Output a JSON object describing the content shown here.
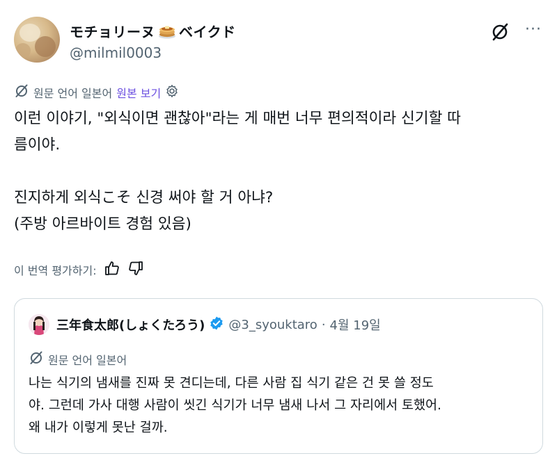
{
  "author": {
    "display_name_prefix": "モチョリーヌ",
    "display_name_suffix": "ベイクド",
    "emoji_icon": "pancake-icon",
    "handle": "@milmil0003"
  },
  "actions": {
    "grok_icon": "grok-icon",
    "more_label": "···"
  },
  "translation": {
    "source_language": "원문 언어 일본어",
    "view_original": "원본 보기",
    "settings_icon": "gear-icon"
  },
  "tweet": {
    "text_lines": [
      "이런 이야기, \"외식이면 괜찮아\"라는 게 매번 너무 편의적이라 신기할 따",
      "름이야.",
      "",
      "진지하게 외식こそ 신경 써야 할 거 아냐?",
      "(주방 아르바이트 경험 있음)"
    ]
  },
  "rate_translation": {
    "label": "이 번역 평가하기:",
    "like_icon": "thumbs-up-icon",
    "dislike_icon": "thumbs-down-icon"
  },
  "quote": {
    "display_name": "三年食太郎(しょくたろう)",
    "verified_icon": "verified-badge-icon",
    "handle": "@3_syouktaro",
    "separator": "·",
    "date": "4월 19일",
    "source_language": "원문 언어 일본어",
    "text_lines": [
      "나는 식기의 냄새를 진짜 못 견디는데, 다른 사람 집 식기 같은 건 못 쓸 정도",
      "야. 그런데 가사 대행 사람이 씻긴 식기가 너무 냄새 나서 그 자리에서 토했어.",
      "왜 내가 이렇게 못난 걸까."
    ]
  },
  "colors": {
    "text": "#0f1419",
    "secondary_text": "#536471",
    "link": "#6b4fe0",
    "verified": "#1d9bf0",
    "border": "#cfd9de"
  }
}
